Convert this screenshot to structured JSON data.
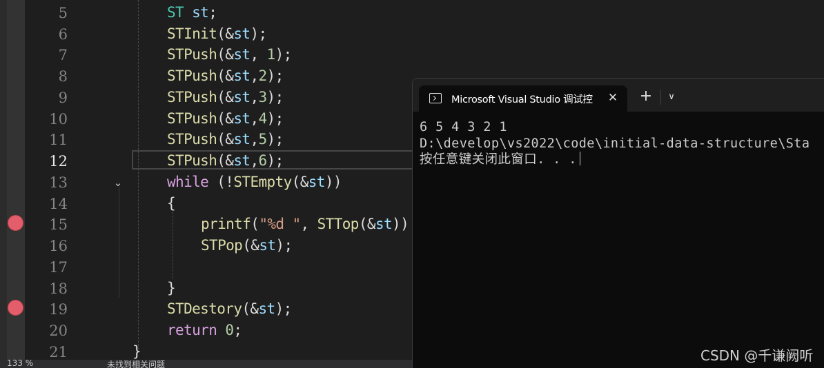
{
  "editor": {
    "line_numbers": [
      "5",
      "6",
      "7",
      "8",
      "9",
      "10",
      "11",
      "12",
      "13",
      "14",
      "15",
      "16",
      "17",
      "18",
      "19",
      "20",
      "21"
    ],
    "active_line": "12",
    "breakpoint_lines": [
      "15",
      "19"
    ],
    "code": {
      "l5": {
        "a": "ST",
        "b": " st",
        "c": ";"
      },
      "l6": {
        "fn": "STInit",
        "a": "(&",
        "v": "st",
        "b": ");"
      },
      "l7": {
        "fn": "STPush",
        "a": "(&",
        "v": "st",
        "b": ", ",
        "n": "1",
        "c": ");"
      },
      "l8": {
        "fn": "STPush",
        "a": "(&",
        "v": "st",
        "b": ",",
        "n": "2",
        "c": ");"
      },
      "l9": {
        "fn": "STPush",
        "a": "(&",
        "v": "st",
        "b": ",",
        "n": "3",
        "c": ");"
      },
      "l10": {
        "fn": "STPush",
        "a": "(&",
        "v": "st",
        "b": ",",
        "n": "4",
        "c": ");"
      },
      "l11": {
        "fn": "STPush",
        "a": "(&",
        "v": "st",
        "b": ",",
        "n": "5",
        "c": ");"
      },
      "l12": {
        "fn": "STPush",
        "a": "(&",
        "v": "st",
        "b": ",",
        "n": "6",
        "c": ");"
      },
      "l13": {
        "kw": "while",
        "a": " (!",
        "fn": "STEmpty",
        "b": "(&",
        "v": "st",
        "c": "))"
      },
      "l14": {
        "a": "{"
      },
      "l15": {
        "fn": "printf",
        "a": "(",
        "s": "\"%d \"",
        "b": ", ",
        "fn2": "STTop",
        "c": "(&",
        "v": "st",
        "d": "))"
      },
      "l16": {
        "fn": "STPop",
        "a": "(&",
        "v": "st",
        "b": ");"
      },
      "l18": {
        "a": "}"
      },
      "l19": {
        "fn": "STDestory",
        "a": "(&",
        "v": "st",
        "b": ");"
      },
      "l20": {
        "kw": "return",
        "a": " ",
        "n": "0",
        "b": ";"
      },
      "l21": {
        "a": "}"
      }
    },
    "status": {
      "zoom": "133 %",
      "issues": "未找到相关问题"
    }
  },
  "console": {
    "tab_title": "Microsoft Visual Studio 调试控",
    "tab_icon": "terminal-icon",
    "close_glyph": "✕",
    "new_tab_glyph": "+",
    "dropdown_glyph": "∨",
    "output": [
      "6 5 4 3 2 1",
      "D:\\develop\\vs2022\\code\\initial-data-structure\\Sta",
      "按任意键关闭此窗口. . ."
    ]
  },
  "watermark": "CSDN @千谦阙听",
  "colors": {
    "editor_bg": "#1e1e1e",
    "console_bg": "#0c0c0c",
    "breakpoint": "#e35d6a",
    "function": "#dcdcaa",
    "variable": "#9cdcfe",
    "keyword": "#d8a0df",
    "type": "#4ec9b0",
    "number": "#b5cea8",
    "string": "#d69d85"
  }
}
